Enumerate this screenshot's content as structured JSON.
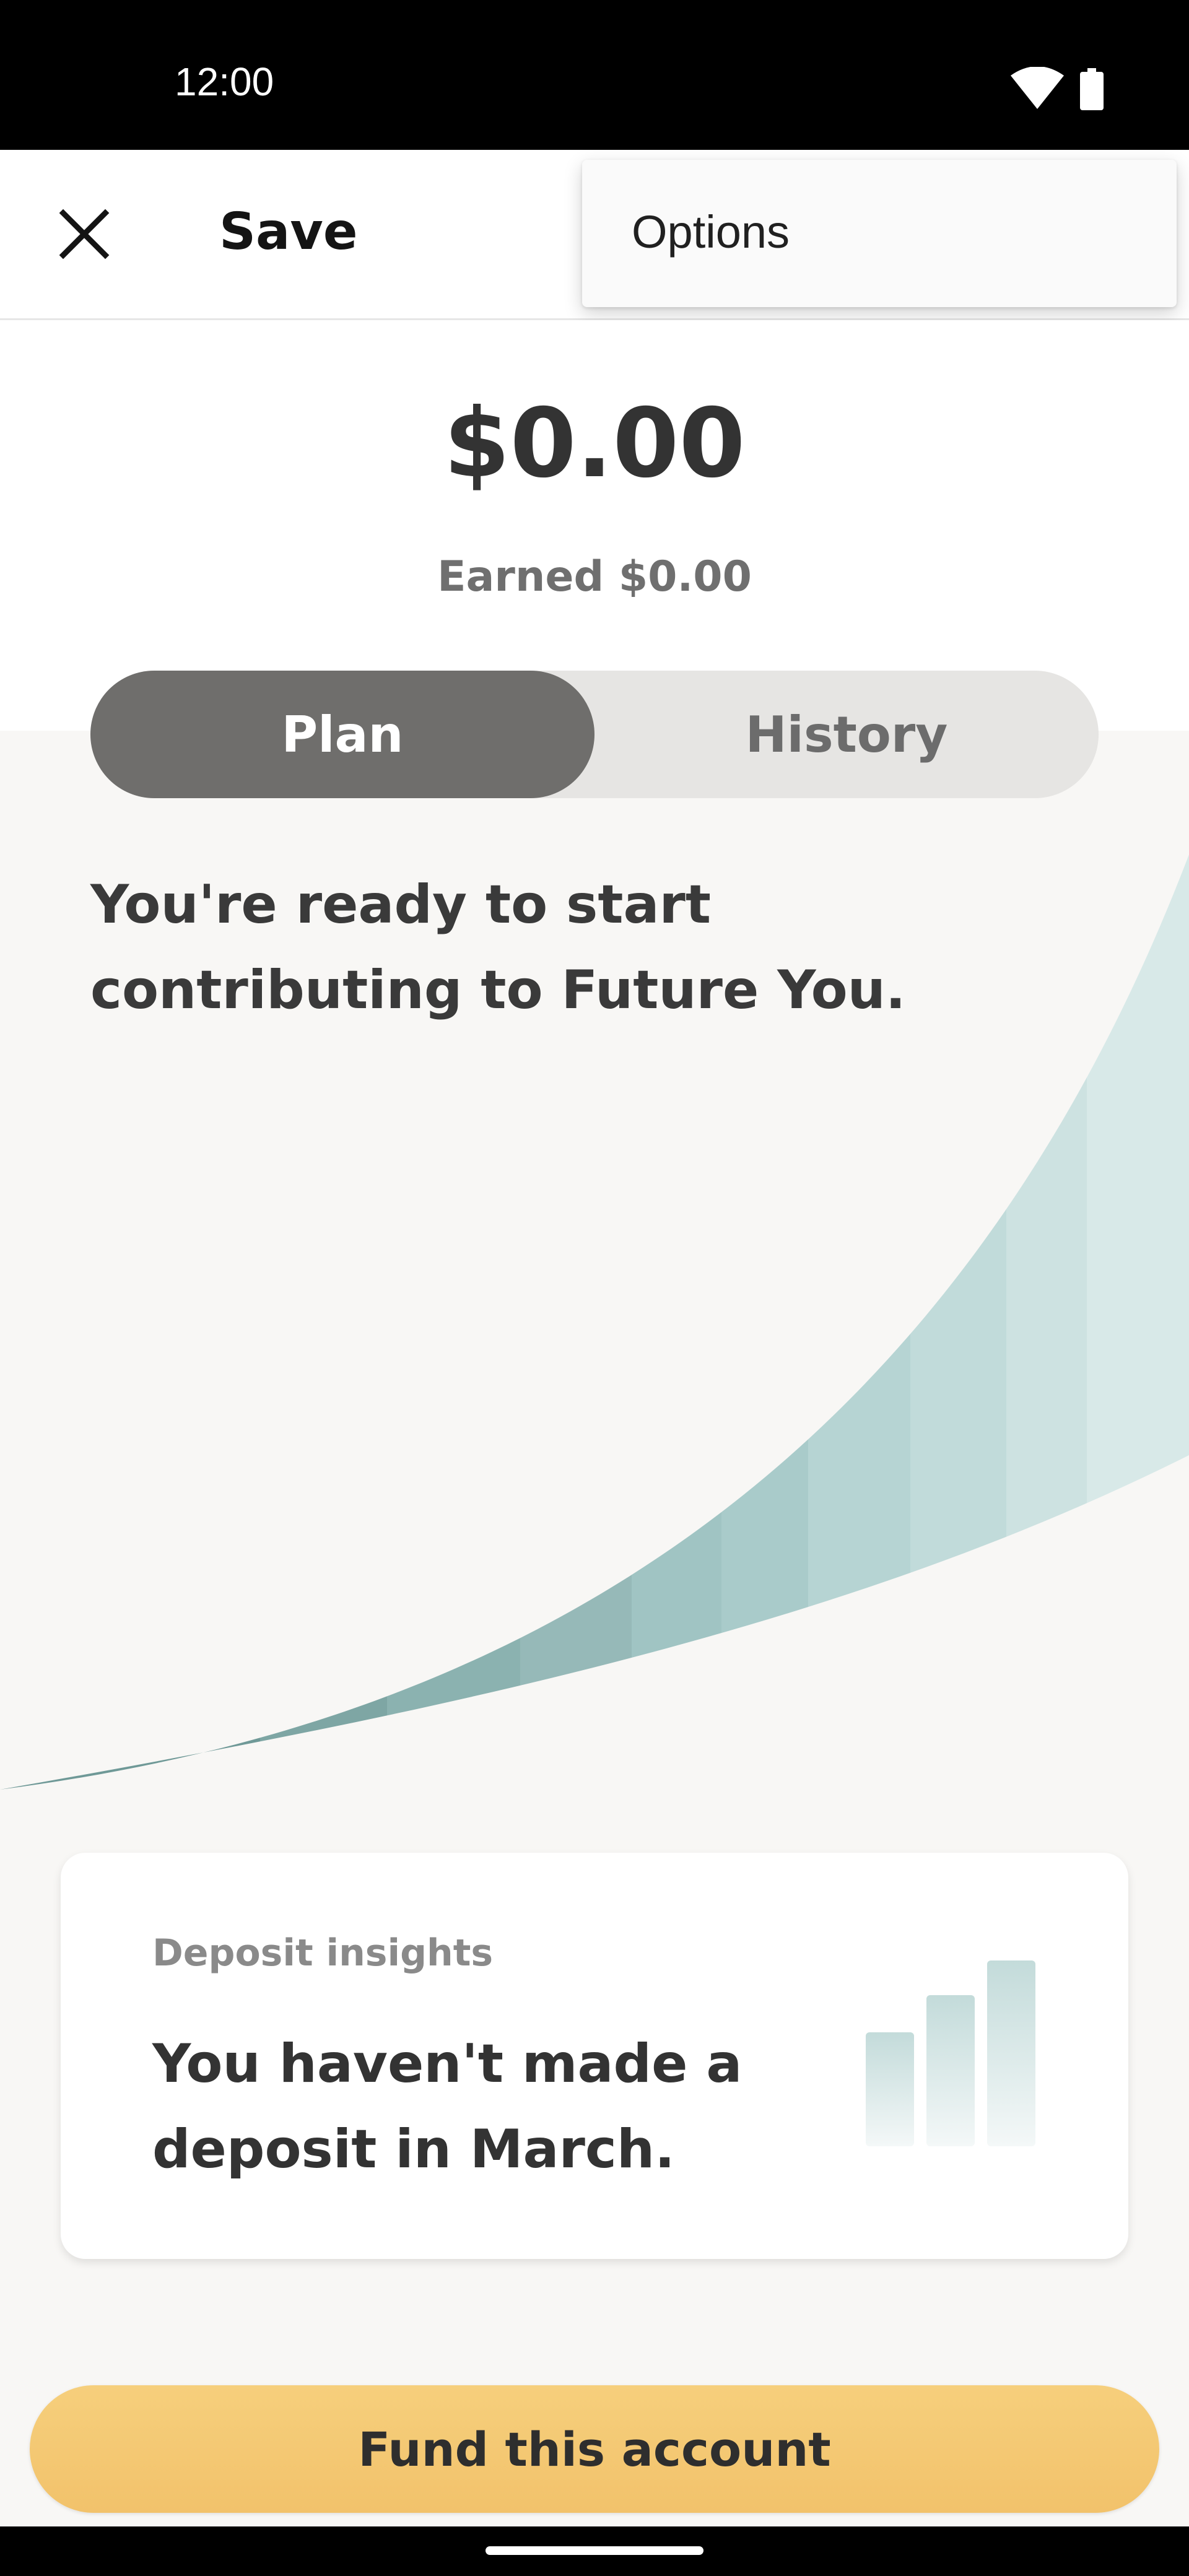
{
  "status_bar": {
    "time": "12:00",
    "wifi_icon": "wifi-icon",
    "battery_icon": "battery-icon"
  },
  "app_bar": {
    "title": "Save",
    "close_icon": "close-icon"
  },
  "menu": {
    "items": [
      "Options"
    ]
  },
  "balance": {
    "amount": "$0.00",
    "earned": "Earned $0.00"
  },
  "tabs": [
    {
      "label": "Plan",
      "selected": true
    },
    {
      "label": "History",
      "selected": false
    }
  ],
  "plan": {
    "message": "You're ready to start contributing to Future You."
  },
  "insights": {
    "kicker": "Deposit insights",
    "message": "You haven't made a deposit in March.",
    "icon": "bar-chart-icon"
  },
  "fund_button": {
    "label": "Fund this account"
  },
  "colors": {
    "accent_teal": "#6e9b98",
    "fund_yellow": "#f4c873",
    "tab_selected": "#6f6e6c"
  }
}
